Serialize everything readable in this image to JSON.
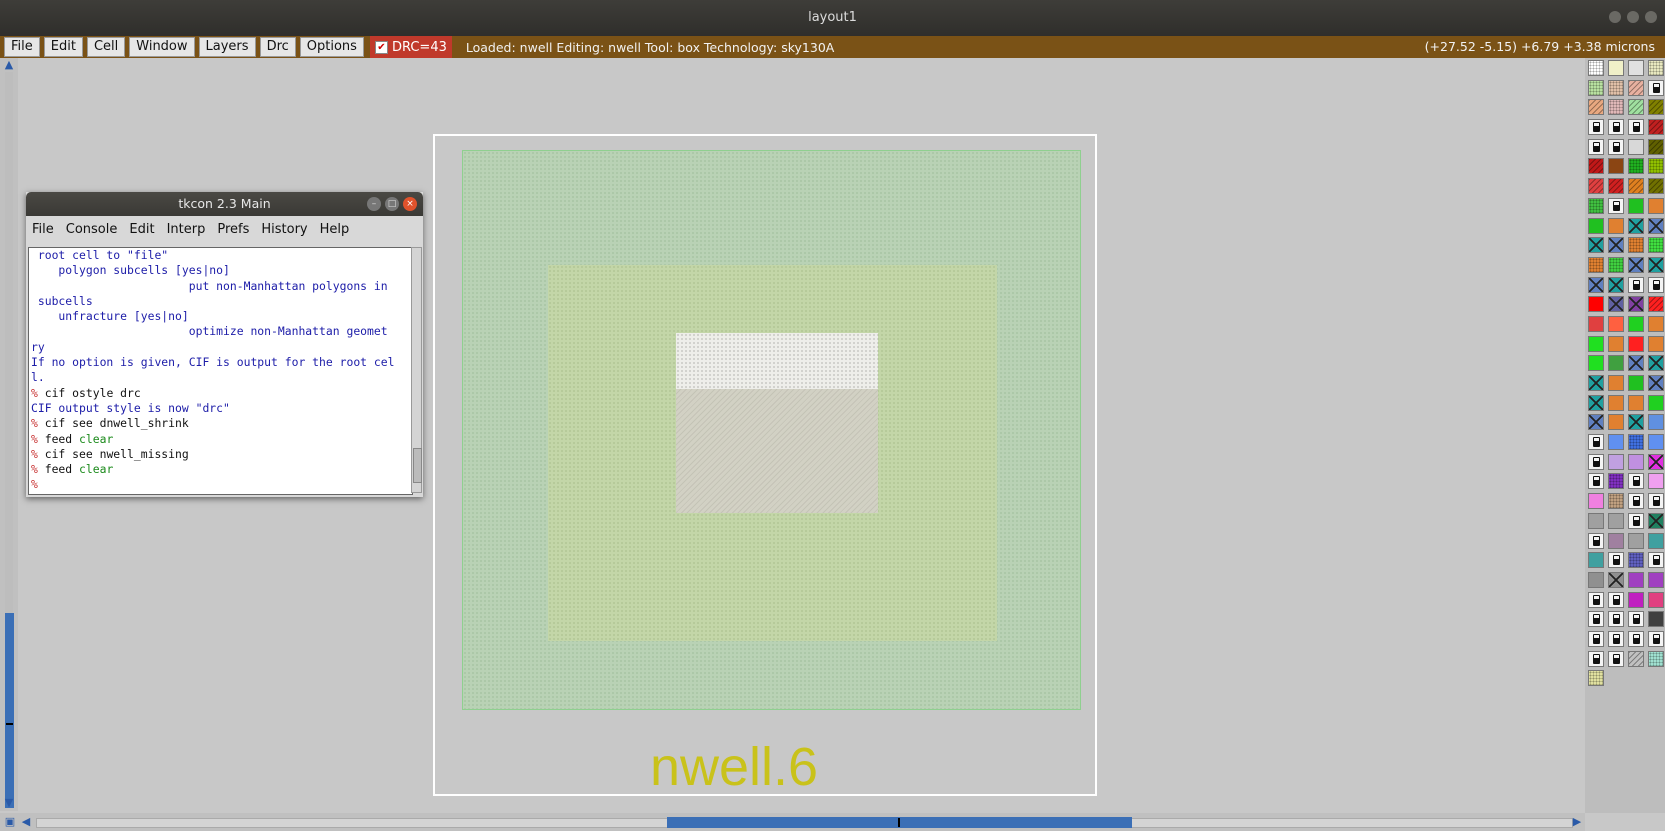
{
  "window": {
    "title": "layout1"
  },
  "menubar": {
    "items": [
      "File",
      "Edit",
      "Cell",
      "Window",
      "Layers",
      "Drc",
      "Options"
    ],
    "drc_label": "DRC=43",
    "drc_checked": true,
    "status": "Loaded: nwell  Editing: nwell  Tool: box   Technology: sky130A",
    "coords": "(+27.52 -5.15) +6.79 +3.38 microns"
  },
  "canvas": {
    "drc_error_label": "nwell.6",
    "colors": {
      "outer_well": "#b9d2b5",
      "inner_well": "#c3d6a8",
      "label": "#c9c21a",
      "frame": "#ffffff"
    }
  },
  "tkcon": {
    "title": "tkcon 2.3 Main",
    "menu": [
      "File",
      "Console",
      "Edit",
      "Interp",
      "Prefs",
      "History",
      "Help"
    ],
    "lines": [
      {
        "p": "",
        "c": "",
        "o": " root cell to \"file\"",
        "k": ""
      },
      {
        "p": "",
        "c": "",
        "o": "    polygon subcells [yes|no]",
        "k": ""
      },
      {
        "p": "",
        "c": "",
        "o": "                       put non-Manhattan polygons in",
        "k": ""
      },
      {
        "p": "",
        "c": "",
        "o": " subcells",
        "k": ""
      },
      {
        "p": "",
        "c": "",
        "o": "    unfracture [yes|no]",
        "k": ""
      },
      {
        "p": "",
        "c": "",
        "o": "                       optimize non-Manhattan geomet",
        "k": ""
      },
      {
        "p": "",
        "c": "",
        "o": "ry",
        "k": ""
      },
      {
        "p": "",
        "c": "",
        "o": "If no option is given, CIF is output for the root cel",
        "k": ""
      },
      {
        "p": "",
        "c": "",
        "o": "l.",
        "k": ""
      },
      {
        "p": "% ",
        "c": "cif ostyle drc",
        "o": "",
        "k": ""
      },
      {
        "p": "",
        "c": "",
        "o": "CIF output style is now \"drc\"",
        "k": ""
      },
      {
        "p": "% ",
        "c": "cif see dnwell_shrink",
        "o": "",
        "k": ""
      },
      {
        "p": "% ",
        "c": "feed ",
        "o": "",
        "k": "clear"
      },
      {
        "p": "% ",
        "c": "cif see nwell_missing",
        "o": "",
        "k": ""
      },
      {
        "p": "% ",
        "c": "feed ",
        "o": "",
        "k": "clear"
      },
      {
        "p": "%",
        "c": "",
        "o": "",
        "k": ""
      }
    ]
  },
  "palette": {
    "swatches": [
      [
        "#ffffff|dots",
        "#f0f0c8|",
        "#e0e0e0|",
        "#e8e8c0|dots"
      ],
      [
        "#b8e0a0|dots",
        "#e0c0a8|dots",
        "#e8b0a0|hatch",
        "L"
      ],
      [
        "#e8a880|hatch",
        "#e0b8b8|dots",
        "#a0e0a0|hatch",
        "#808000|hatch"
      ],
      [
        "L",
        "L",
        "L",
        "#c02020|hatch"
      ],
      [
        "L",
        "L",
        "#d8d8d8|",
        "#606000|hatch"
      ],
      [
        "#c01818|hatch",
        "#8b4513|",
        "#20b020|dots",
        "#90c000|dots"
      ],
      [
        "#e04040|hatch",
        "#d02020|hatch",
        "#e08020|hatch",
        "#707000|hatch"
      ],
      [
        "#40c040|dots",
        "L",
        "#20c020|",
        "#e08030|"
      ],
      [
        "#20c020|",
        "#e08030|",
        "#20a0a0|xx",
        "#6080c0|xx"
      ],
      [
        "#20a0a0|xx",
        "#6080c0|xx",
        "#e08030|dots",
        "#40e040|dots"
      ],
      [
        "#e08030|dots",
        "#40d040|dots",
        "#6080c0|xx",
        "#20a0a0|xx"
      ],
      [
        "#6080c0|xx",
        "#20a0a0|xx",
        "L",
        "L"
      ],
      [
        "#ff0000|",
        "#6060a0|xx",
        "#8040a0|xx",
        "#ff2020|hatch"
      ],
      [
        "#e04040|",
        "#ff6040|",
        "#20d020|",
        "#e08030|"
      ],
      [
        "#20e020|",
        "#e08030|",
        "#ff2020|",
        "#e08030|"
      ],
      [
        "#20e020|",
        "#40a040|",
        "#6080c0|xx",
        "#20a0a0|xx"
      ],
      [
        "#20a0a0|xx",
        "#e08030|",
        "#20c020|",
        "#6080c0|xx"
      ],
      [
        "#20a0a0|xx",
        "#e08030|",
        "#e08030|",
        "#20d020|"
      ],
      [
        "#6080c0|xx",
        "#e08030|",
        "#20a0a0|xx",
        "#6090e0|"
      ],
      [
        "L",
        "#6090f0|",
        "#4070e0|dots",
        "#6090f0|"
      ],
      [
        "L",
        "#c0a0e0|",
        "#c090e0|",
        "#e030e0|xx"
      ],
      [
        "L",
        "#8030c0|dots",
        "L",
        "#f0a0f0|"
      ],
      [
        "#f080e0|",
        "#c0a080|dots",
        "L",
        "L"
      ],
      [
        "#a0a0a0|",
        "#a0a0a0|",
        "L",
        "#208060|xx"
      ],
      [
        "L",
        "#a080a0|",
        "#a0a0a0|",
        "#40a0a0|"
      ],
      [
        "#40a0a0|",
        "L",
        "#6060c0|dots",
        "L"
      ],
      [
        "#909090|",
        "#909090|xx",
        "#a040c0|",
        "#a040c0|"
      ],
      [
        "L",
        "L",
        "#c020c0|",
        "#e04080|"
      ],
      [
        "L",
        "L",
        "L",
        "#404040|"
      ],
      [
        "L",
        "L",
        "L",
        "L"
      ],
      [
        "L",
        "L",
        "#c0c0c0|hatch",
        "#a0e0d0|dots"
      ],
      [
        "#e0e0a0|dots"
      ]
    ]
  }
}
